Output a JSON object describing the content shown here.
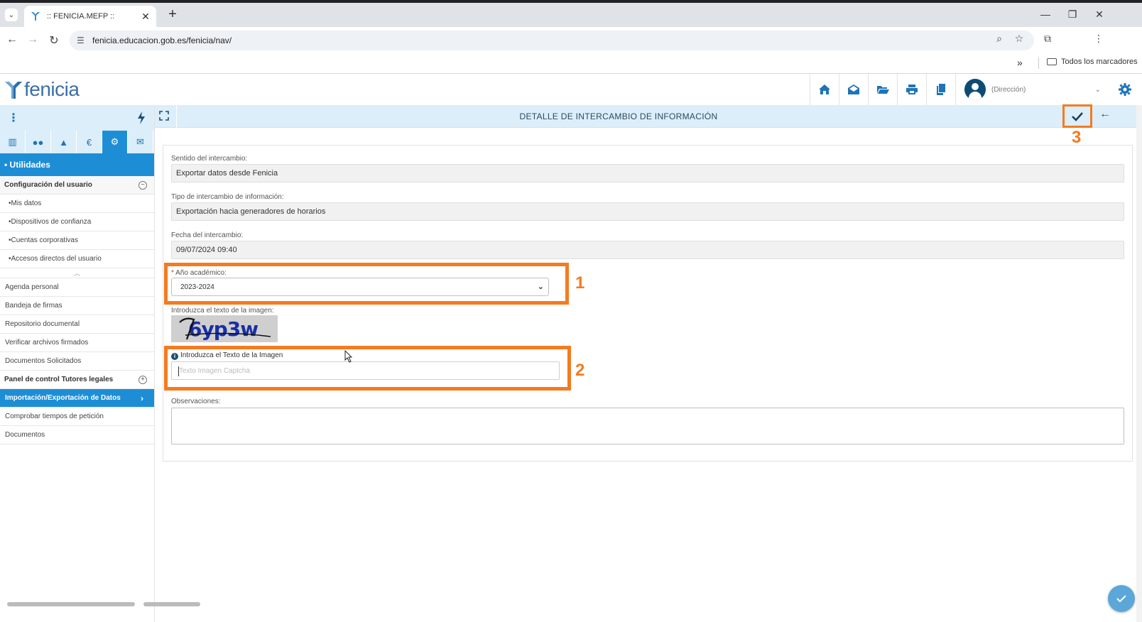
{
  "browser": {
    "tab_title": ":: FENICIA.MEFP ::",
    "url": "fenicia.educacion.gob.es/fenicia/nav/",
    "bookmarks_folder": "Todos los marcadores"
  },
  "app": {
    "logo_text": "fenicia",
    "user_role": "(Dirección)",
    "header_icons": [
      "home-icon",
      "inbox-icon",
      "folder-open-icon",
      "print-icon",
      "documents-icon"
    ]
  },
  "sidebar": {
    "tabs": [
      "building-icon",
      "users-icon",
      "graduation-cap-icon",
      "euro-icon",
      "cogs-icon",
      "envelope-icon"
    ],
    "section": "• Utilidades",
    "group1": {
      "label": "Configuración del usuario",
      "toggle": "−",
      "items": [
        "•Mis datos",
        "•Dispositivos de confianza",
        "•Cuentas corporativas",
        "•Accesos directos del usuario"
      ]
    },
    "items_a": [
      "Agenda personal",
      "Bandeja de firmas",
      "Repositorio documental",
      "Verificar archivos firmados",
      "Documentos Solicitados"
    ],
    "group2": {
      "label": "Panel de control Tutores legales",
      "toggle": "+"
    },
    "active_item": "Importación/Exportación de Datos",
    "items_b": [
      "Comprobar tiempos de petición",
      "Documentos"
    ]
  },
  "content": {
    "title": "DETALLE DE INTERCAMBIO DE INFORMACIÓN",
    "fields": {
      "sentido_label": "Sentido del intercambio:",
      "sentido_value": "Exportar datos desde Fenicia",
      "tipo_label": "Tipo de intercambio de información:",
      "tipo_value": "Exportación hacia generadores de horarios",
      "fecha_label": "Fecha del intercambio:",
      "fecha_value": "09/07/2024 09:40",
      "anio_required": "*",
      "anio_label": "Año académico:",
      "anio_value": "2023-2024",
      "captcha_label": "Introduzca el texto de la imagen:",
      "captcha_text": "6yp3w",
      "captcha_input_label": "Introduzca el Texto de la Imagen",
      "captcha_placeholder": "Texto Imagen Captcha",
      "obs_label": "Observaciones:"
    }
  },
  "annotations": {
    "n1": "1",
    "n2": "2",
    "n3": "3",
    "color": "#f47b20"
  },
  "colors": {
    "primary": "#1d8ed6",
    "header_bg": "#dbeef9",
    "highlight": "#f47b20"
  }
}
